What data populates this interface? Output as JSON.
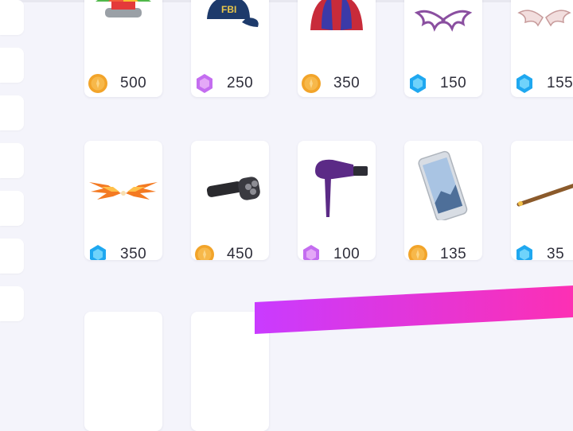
{
  "shop": {
    "rows": [
      {
        "items": [
          {
            "name": "umbrella-hat",
            "currency": "coin",
            "price": "500"
          },
          {
            "name": "fbi-cap",
            "currency": "gem-purple",
            "price": "250"
          },
          {
            "name": "striped-beanie",
            "currency": "coin",
            "price": "350"
          },
          {
            "name": "bat-wings",
            "currency": "gem-blue",
            "price": "150"
          },
          {
            "name": "angel-wings",
            "currency": "gem-blue",
            "price": "155"
          }
        ]
      },
      {
        "items": [
          {
            "name": "fire-wings",
            "currency": "gem-blue",
            "price": "350"
          },
          {
            "name": "flashlight",
            "currency": "coin",
            "price": "450"
          },
          {
            "name": "hair-dryer",
            "currency": "gem-purple",
            "price": "100"
          },
          {
            "name": "smartphone",
            "currency": "coin",
            "price": "135"
          },
          {
            "name": "wooden-wand",
            "currency": "gem-blue",
            "price": "35"
          }
        ]
      }
    ]
  },
  "colors": {
    "background": "#f4f4fb",
    "coin": "#f2a42a",
    "gem_blue": "#1fa8f0",
    "gem_purple": "#c46df0",
    "accent_bar": "#d63cf0"
  }
}
